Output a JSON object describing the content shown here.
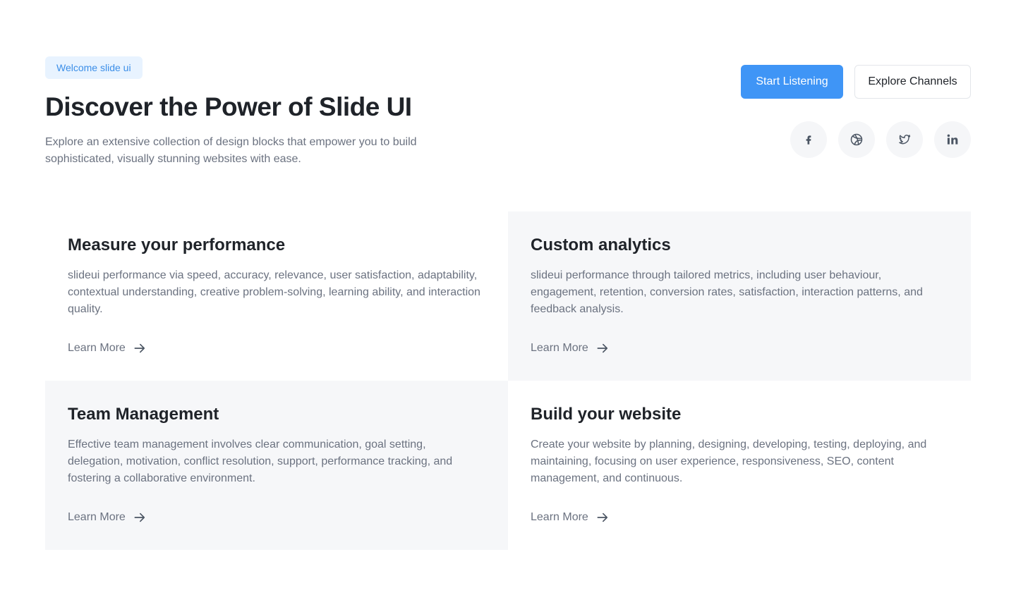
{
  "header": {
    "badge": "Welcome slide ui",
    "title": "Discover the Power of Slide UI",
    "subtitle": "Explore an extensive collection of design blocks that empower you to build sophisticated, visually stunning websites with ease."
  },
  "actions": {
    "primary_label": "Start Listening",
    "secondary_label": "Explore Channels"
  },
  "socials": [
    {
      "name": "facebook-icon"
    },
    {
      "name": "dribbble-icon"
    },
    {
      "name": "twitter-icon"
    },
    {
      "name": "linkedin-icon"
    }
  ],
  "cards": [
    {
      "title": "Measure your performance",
      "text": "slideui performance via speed, accuracy, relevance, user satisfaction, adaptability, contextual understanding, creative problem-solving, learning ability, and interaction quality.",
      "link": "Learn More"
    },
    {
      "title": "Custom analytics",
      "text": "slideui performance through tailored metrics, including user behaviour, engagement, retention, conversion rates, satisfaction, interaction patterns, and feedback analysis.",
      "link": "Learn More"
    },
    {
      "title": "Team Management",
      "text": "Effective team management involves clear communication, goal setting, delegation, motivation, conflict resolution, support, performance tracking, and fostering a collaborative environment.",
      "link": "Learn More"
    },
    {
      "title": "Build your website",
      "text": "Create your website by planning, designing, developing, testing, deploying, and maintaining, focusing on user experience, responsiveness, SEO, content management, and continuous.",
      "link": "Learn More"
    }
  ],
  "colors": {
    "accent": "#3f95f6",
    "badge_bg": "#e8f3ff",
    "badge_text": "#3b8ee8",
    "card_shade": "#f6f7f9",
    "muted_text": "#6b7280"
  }
}
